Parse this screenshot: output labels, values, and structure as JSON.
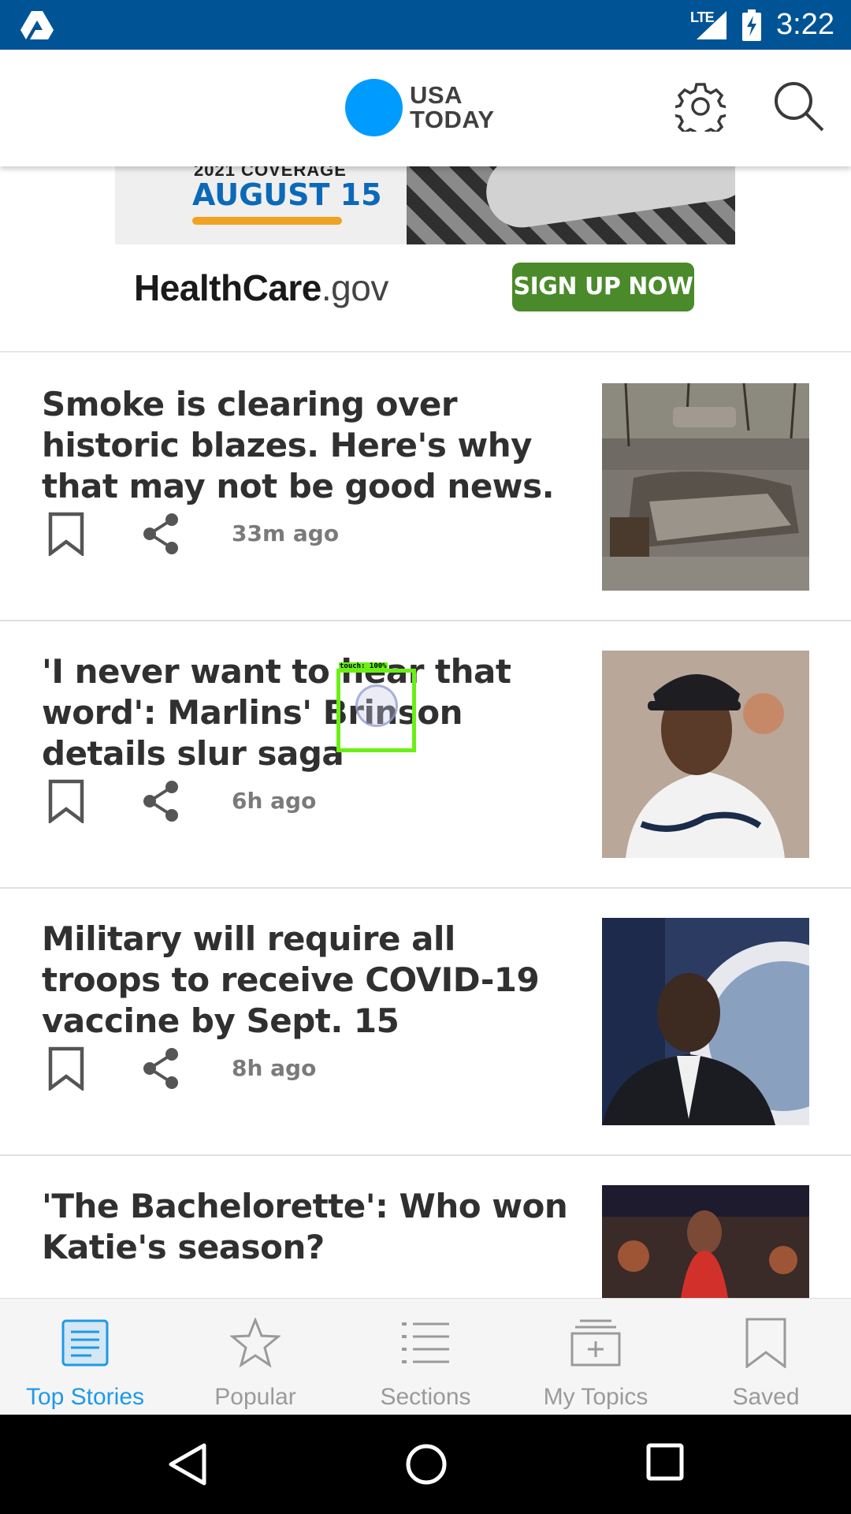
{
  "status_bar": {
    "time": "3:22",
    "network": "LTE"
  },
  "header": {
    "logo_line1": "USA",
    "logo_line2": "TODAY",
    "brand_color": "#009BFF"
  },
  "ad": {
    "banner_small": "2021 COVERAGE",
    "banner_date": "AUGUST 15",
    "brand_bold": "HealthCare",
    "brand_suffix": ".gov",
    "cta": "SIGN UP NOW"
  },
  "articles": [
    {
      "headline": "Smoke is clearing over historic blazes. Here's why that may not be good news.",
      "time": "33m ago",
      "thumb": "burned-car-photo"
    },
    {
      "headline": "'I never want to hear that word': Marlins' Brinson details slur saga",
      "time": "6h ago",
      "thumb": "marlins-player-photo"
    },
    {
      "headline": "Military will require all troops to receive COVID-19 vaccine by Sept. 15",
      "time": "8h ago",
      "thumb": "pentagon-official-photo"
    },
    {
      "headline": "'The Bachelorette': Who won Katie's season?",
      "time": "",
      "thumb": "bachelorette-photo"
    }
  ],
  "touch_overlay": {
    "label": "touch: 100%"
  },
  "bottom_nav": [
    {
      "label": "Top Stories",
      "icon": "newspaper-icon",
      "active": true
    },
    {
      "label": "Popular",
      "icon": "star-icon",
      "active": false
    },
    {
      "label": "Sections",
      "icon": "list-icon",
      "active": false
    },
    {
      "label": "My Topics",
      "icon": "add-topic-icon",
      "active": false
    },
    {
      "label": "Saved",
      "icon": "bookmark-icon",
      "active": false
    }
  ],
  "colors": {
    "status_bar": "#005496",
    "active_tab": "#1e9ae6",
    "ad_button": "#4a8a2a"
  }
}
